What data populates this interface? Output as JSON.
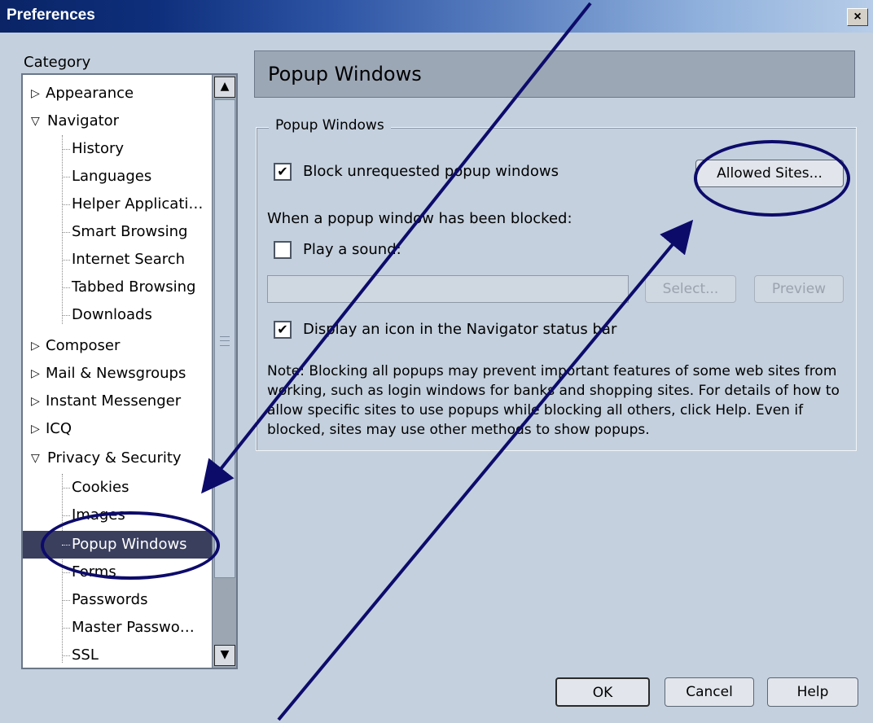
{
  "window": {
    "title": "Preferences",
    "close_glyph": "×"
  },
  "category": {
    "label": "Category",
    "items": [
      {
        "label": "Appearance",
        "twisty": "▷"
      },
      {
        "label": "Navigator",
        "twisty": "▽"
      },
      {
        "label": "History"
      },
      {
        "label": "Languages"
      },
      {
        "label": "Helper Applicati…"
      },
      {
        "label": "Smart Browsing"
      },
      {
        "label": "Internet Search"
      },
      {
        "label": "Tabbed Browsing"
      },
      {
        "label": "Downloads"
      },
      {
        "label": "Composer",
        "twisty": "▷"
      },
      {
        "label": "Mail & Newsgroups",
        "twisty": "▷"
      },
      {
        "label": "Instant Messenger",
        "twisty": "▷"
      },
      {
        "label": "ICQ",
        "twisty": "▷"
      },
      {
        "label": "Privacy & Security",
        "twisty": "▽"
      },
      {
        "label": "Cookies"
      },
      {
        "label": "Images"
      },
      {
        "label": "Popup Windows",
        "selected": true
      },
      {
        "label": "Forms"
      },
      {
        "label": "Passwords"
      },
      {
        "label": "Master Passwo…"
      },
      {
        "label": "SSL"
      }
    ],
    "scroll_up_glyph": "▲",
    "scroll_down_glyph": "▼"
  },
  "panel": {
    "header": "Popup Windows",
    "group_legend": "Popup Windows",
    "block_checkbox": {
      "checked": true,
      "label": "Block unrequested popup windows",
      "mark": "✔"
    },
    "allowed_sites_button": "Allowed Sites...",
    "blocked_heading": "When a popup window has been blocked:",
    "sound_checkbox": {
      "checked": false,
      "label": "Play a sound:"
    },
    "sound_file": {
      "value": ""
    },
    "select_button": "Select...",
    "preview_button": "Preview",
    "status_icon_checkbox": {
      "checked": true,
      "label": "Display an icon in the Navigator status bar",
      "mark": "✔"
    },
    "note": "Note: Blocking all popups may prevent important features of some web sites from working, such as login windows for banks and shopping sites. For details of how to allow specific sites to use popups while blocking all others, click Help. Even if blocked, sites may use other methods to show popups."
  },
  "footer": {
    "ok": "OK",
    "cancel": "Cancel",
    "help": "Help"
  },
  "colors": {
    "background": "#c4d0de",
    "selection": "#3a3f5e",
    "annotation": "#0d0b6a"
  }
}
